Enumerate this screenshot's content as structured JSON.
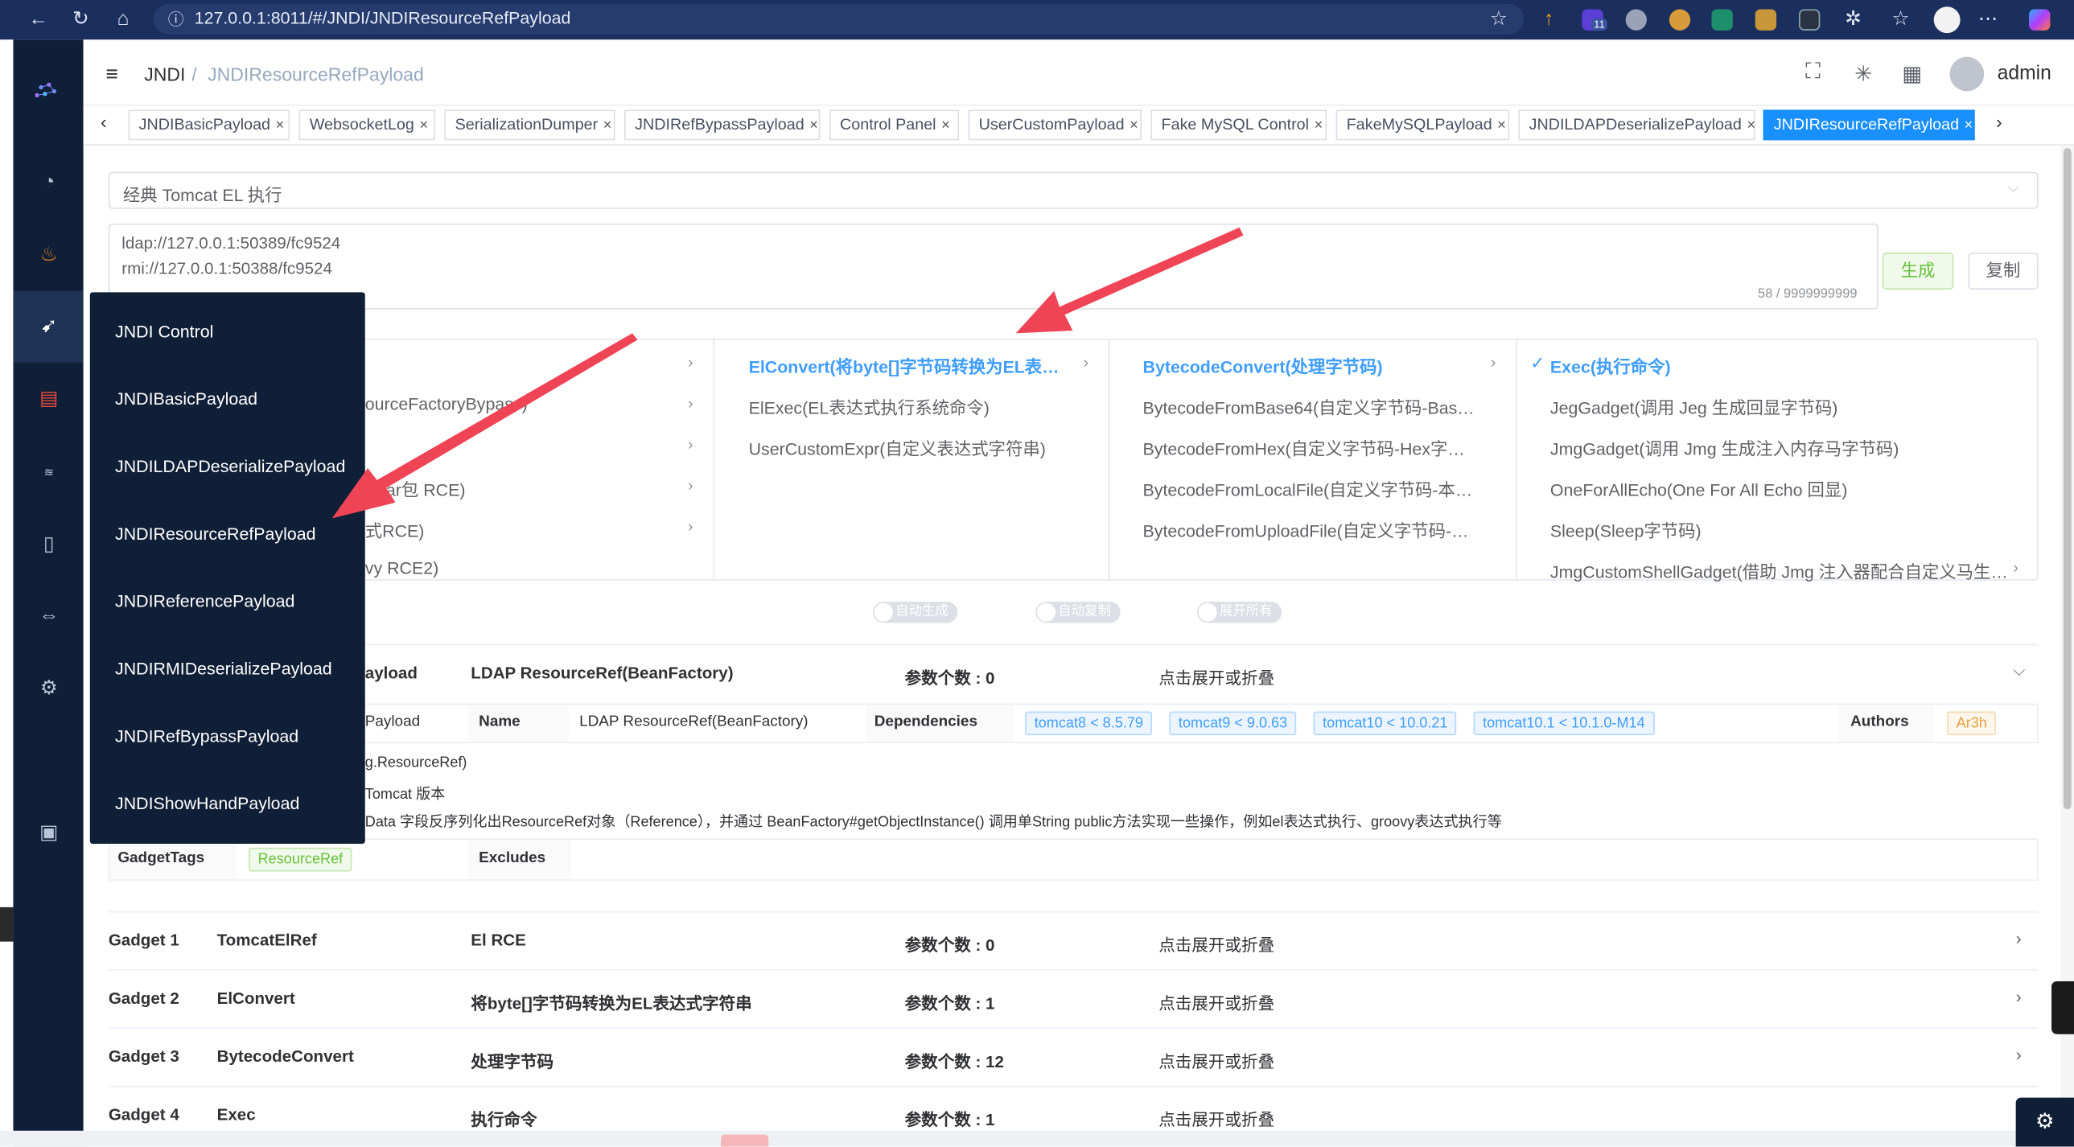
{
  "browser": {
    "url": "127.0.0.1:8011/#/JNDI/JNDIResourceRefPayload",
    "badge": "11"
  },
  "header": {
    "breadcrumb_root": "JNDI",
    "breadcrumb_sep": "/",
    "breadcrumb_current": "JNDIResourceRefPayload",
    "user": "admin"
  },
  "tabs": [
    {
      "label": "JNDIBasicPayload"
    },
    {
      "label": "WebsocketLog"
    },
    {
      "label": "SerializationDumper"
    },
    {
      "label": "JNDIRefBypassPayload"
    },
    {
      "label": "Control Panel"
    },
    {
      "label": "UserCustomPayload"
    },
    {
      "label": "Fake MySQL Control"
    },
    {
      "label": "FakeMySQLPayload"
    },
    {
      "label": "JNDILDAPDeserializePayload"
    },
    {
      "label": "JNDIResourceRefPayload"
    }
  ],
  "main": {
    "select_value": "经典 Tomcat EL 执行",
    "ldap_url": "ldap://127.0.0.1:50389/fc9524",
    "rmi_url": "rmi://127.0.0.1:50388/fc9524",
    "char_count": "58 / 9999999999",
    "generate_btn": "生成",
    "copy_btn": "复制",
    "col1": [
      "ourceFactoryBypass)",
      "",
      "载jar包 RCE)",
      "式RCE)",
      "vy RCE2)"
    ],
    "col2": [
      "ElConvert(将byte[]字节码转换为EL表…",
      "ElExec(EL表达式执行系统命令)",
      "UserCustomExpr(自定义表达式字符串)"
    ],
    "col3": [
      "BytecodeConvert(处理字节码)",
      "BytecodeFromBase64(自定义字节码-Bas…",
      "BytecodeFromHex(自定义字节码-Hex字…",
      "BytecodeFromLocalFile(自定义字节码-本…",
      "BytecodeFromUploadFile(自定义字节码-…"
    ],
    "col4": [
      "Exec(执行命令)",
      "JegGadget(调用 Jeg 生成回显字节码)",
      "JmgGadget(调用 Jmg 生成注入内存马字节码)",
      "OneForAllEcho(One For All Echo 回显)",
      "Sleep(Sleep字节码)",
      "JmgCustomShellGadget(借助 Jmg 注入器配合自定义马生…"
    ],
    "switches": [
      "自动生成",
      "自动复制",
      "展开所有"
    ]
  },
  "payload": {
    "title_tail": "ayload",
    "name_value": "LDAP ResourceRef(BeanFactory)",
    "param_count": "参数个数 : 0",
    "toggle_text": "点击展开或折叠",
    "row_class_tail": "Payload",
    "name_label": "Name",
    "dependencies_label": "Dependencies",
    "deps": [
      "tomcat8 < 8.5.79",
      "tomcat9 < 9.0.63",
      "tomcat10 < 10.0.21",
      "tomcat10.1 < 10.1.0-M14"
    ],
    "authors_label": "Authors",
    "author": "Ar3h",
    "line1": "g.ResourceRef)",
    "line2": "Tomcat 版本",
    "line3": "Data 字段反序列化出ResourceRef对象（Reference），并通过 BeanFactory#getObjectInstance() 调用单String public方法实现一些操作，例如el表达式执行、groovy表达式执行等",
    "gadget_tags_label": "GadgetTags",
    "gadget_tag": "ResourceRef",
    "excludes_label": "Excludes"
  },
  "gadgets": [
    {
      "idx": "Gadget 1",
      "name": "TomcatElRef",
      "desc": "El RCE",
      "params": "参数个数 : 0",
      "toggle": "点击展开或折叠"
    },
    {
      "idx": "Gadget 2",
      "name": "ElConvert",
      "desc": "将byte[]字节码转换为EL表达式字符串",
      "params": "参数个数 : 1",
      "toggle": "点击展开或折叠"
    },
    {
      "idx": "Gadget 3",
      "name": "BytecodeConvert",
      "desc": "处理字节码",
      "params": "参数个数 : 12",
      "toggle": "点击展开或折叠"
    },
    {
      "idx": "Gadget 4",
      "name": "Exec",
      "desc": "执行命令",
      "params": "参数个数 : 1",
      "toggle": "点击展开或折叠"
    }
  ],
  "dropdown": [
    "JNDI Control",
    "JNDIBasicPayload",
    "JNDILDAPDeserializePayload",
    "JNDIResourceRefPayload",
    "JNDIReferencePayload",
    "JNDIRMIDeserializePayload",
    "JNDIRefBypassPayload",
    "JNDIShowHandPayload"
  ],
  "colors": {
    "accent": "#1890ff",
    "sidebar": "#0f1f37",
    "arrow": "#ee4455"
  }
}
